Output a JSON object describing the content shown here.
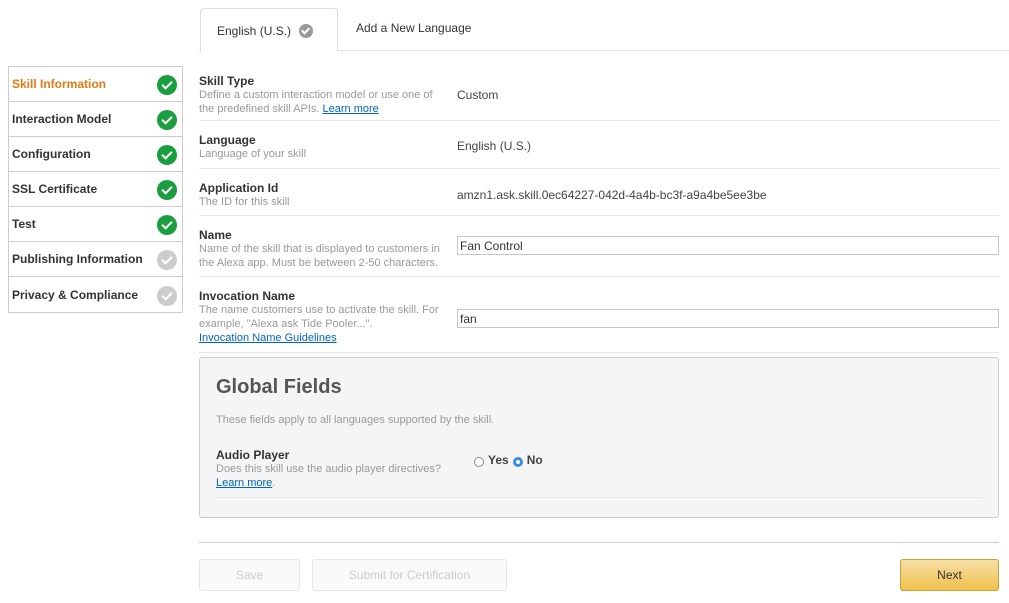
{
  "tabs": {
    "active": {
      "label": "English (U.S.)",
      "icon": "check-circle-icon"
    },
    "add": {
      "label": "Add a New Language"
    }
  },
  "sidebar": {
    "items": [
      {
        "label": "Skill Information",
        "active": true,
        "status": "complete"
      },
      {
        "label": "Interaction Model",
        "active": false,
        "status": "complete"
      },
      {
        "label": "Configuration",
        "active": false,
        "status": "complete"
      },
      {
        "label": "SSL Certificate",
        "active": false,
        "status": "complete"
      },
      {
        "label": "Test",
        "active": false,
        "status": "complete"
      },
      {
        "label": "Publishing Information",
        "active": false,
        "status": "pending"
      },
      {
        "label": "Privacy & Compliance",
        "active": false,
        "status": "pending"
      }
    ]
  },
  "form": {
    "skill_type": {
      "label": "Skill Type",
      "desc": "Define a custom interaction model or use one of the predefined skill APIs.",
      "link": "Learn more",
      "value": "Custom"
    },
    "language": {
      "label": "Language",
      "desc": "Language of your skill",
      "value": "English (U.S.)"
    },
    "application_id": {
      "label": "Application Id",
      "desc": "The ID for this skill",
      "value": "amzn1.ask.skill.0ec64227-042d-4a4b-bc3f-a9a4be5ee3be"
    },
    "name": {
      "label": "Name",
      "desc": "Name of the skill that is displayed to customers in the Alexa app. Must be between 2-50 characters.",
      "value": "Fan Control"
    },
    "invocation_name": {
      "label": "Invocation Name",
      "desc": "The name customers use to activate the skill. For example, \"Alexa ask Tide Pooler...\".",
      "link": "Invocation Name Guidelines",
      "value": "fan"
    }
  },
  "global": {
    "title": "Global Fields",
    "desc": "These fields apply to all languages supported by the skill.",
    "audio_player": {
      "label": "Audio Player",
      "desc": "Does this skill use the audio player directives?",
      "link": "Learn more",
      "link_suffix": ".",
      "options": [
        "Yes",
        "No"
      ],
      "selected": "No"
    }
  },
  "footer": {
    "save": "Save",
    "submit": "Submit for Certification",
    "next": "Next"
  },
  "colors": {
    "accent": "#e47911",
    "complete": "#1a9e3f",
    "pending": "#cccccc",
    "link": "#0066c0",
    "radio_selected": "#3a8ee6"
  }
}
